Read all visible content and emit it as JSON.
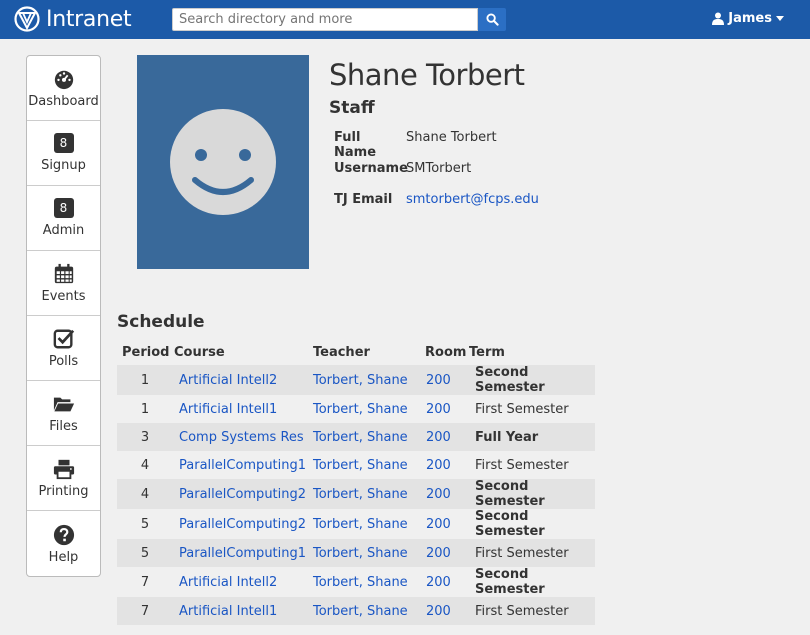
{
  "header": {
    "brand": "Intranet",
    "search_placeholder": "Search directory and more",
    "user_name": "James"
  },
  "sidebar": {
    "items": [
      {
        "label": "Dashboard",
        "icon": "dashboard-icon"
      },
      {
        "label": "Signup",
        "badge": "8"
      },
      {
        "label": "Admin",
        "badge": "8"
      },
      {
        "label": "Events",
        "icon": "calendar-icon"
      },
      {
        "label": "Polls",
        "icon": "checkbox-icon"
      },
      {
        "label": "Files",
        "icon": "folder-icon"
      },
      {
        "label": "Printing",
        "icon": "printer-icon"
      },
      {
        "label": "Help",
        "icon": "help-icon"
      }
    ]
  },
  "profile": {
    "name": "Shane Torbert",
    "role": "Staff",
    "fields": [
      {
        "label": "Full Name",
        "value": "Shane Torbert"
      },
      {
        "label": "Username",
        "value": "SMTorbert"
      },
      {
        "label": "TJ Email",
        "value": "smtorbert@fcps.edu"
      }
    ]
  },
  "schedule": {
    "title": "Schedule",
    "columns": [
      "Period",
      "Course",
      "Teacher",
      "Room",
      "Term"
    ],
    "rows": [
      {
        "period": "1",
        "course": "Artificial Intell2",
        "teacher": "Torbert, Shane",
        "room": "200",
        "term": "Second Semester"
      },
      {
        "period": "1",
        "course": "Artificial Intell1",
        "teacher": "Torbert, Shane",
        "room": "200",
        "term": "First Semester"
      },
      {
        "period": "3",
        "course": "Comp Systems Res",
        "teacher": "Torbert, Shane",
        "room": "200",
        "term": "Full Year"
      },
      {
        "period": "4",
        "course": "ParallelComputing1",
        "teacher": "Torbert, Shane",
        "room": "200",
        "term": "First Semester"
      },
      {
        "period": "4",
        "course": "ParallelComputing2",
        "teacher": "Torbert, Shane",
        "room": "200",
        "term": "Second Semester"
      },
      {
        "period": "5",
        "course": "ParallelComputing2",
        "teacher": "Torbert, Shane",
        "room": "200",
        "term": "Second Semester"
      },
      {
        "period": "5",
        "course": "ParallelComputing1",
        "teacher": "Torbert, Shane",
        "room": "200",
        "term": "First Semester"
      },
      {
        "period": "7",
        "course": "Artificial Intell2",
        "teacher": "Torbert, Shane",
        "room": "200",
        "term": "Second Semester"
      },
      {
        "period": "7",
        "course": "Artificial Intell1",
        "teacher": "Torbert, Shane",
        "room": "200",
        "term": "First Semester"
      }
    ]
  },
  "colors": {
    "header_bg": "#1c5aa8",
    "avatar_bg": "#39699a",
    "link": "#1a56c4",
    "page_bg": "#f0f0f0"
  }
}
